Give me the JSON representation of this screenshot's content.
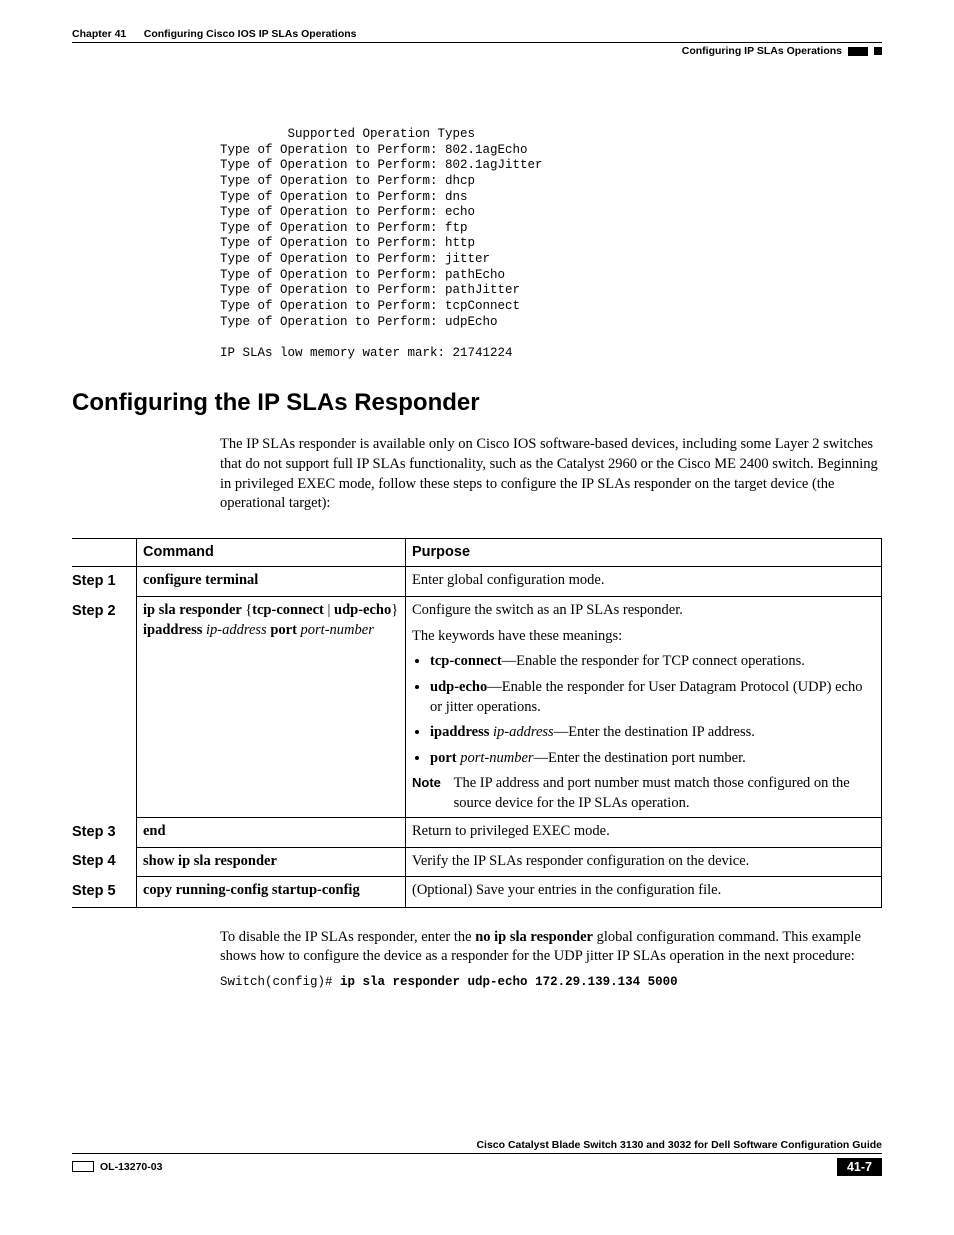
{
  "header": {
    "chapter_line": "Chapter 41      Configuring Cisco IOS IP SLAs Operations",
    "section_right": "Configuring IP SLAs Operations"
  },
  "console_block": "         Supported Operation Types\nType of Operation to Perform: 802.1agEcho\nType of Operation to Perform: 802.1agJitter\nType of Operation to Perform: dhcp\nType of Operation to Perform: dns\nType of Operation to Perform: echo\nType of Operation to Perform: ftp\nType of Operation to Perform: http\nType of Operation to Perform: jitter\nType of Operation to Perform: pathEcho\nType of Operation to Perform: pathJitter\nType of Operation to Perform: tcpConnect\nType of Operation to Perform: udpEcho\n\nIP SLAs low memory water mark: 21741224",
  "section_title": "Configuring the IP SLAs Responder",
  "intro_paragraph": "The IP SLAs responder is available only on Cisco IOS software-based devices, including some Layer 2 switches that do not support full IP SLAs functionality, such as the Catalyst 2960 or the Cisco ME 2400 switch. Beginning in privileged EXEC mode, follow these steps to configure the IP SLAs responder on the target device (the operational target):",
  "table": {
    "col1_header": "Command",
    "col2_header": "Purpose",
    "steps": [
      {
        "label": "Step 1",
        "command_bold": "configure terminal",
        "purpose_html": "Enter global configuration mode."
      },
      {
        "label": "Step 2",
        "cmd_line1_b1": "ip sla responder ",
        "cmd_line1_plain": "{",
        "cmd_line1_b2": "tcp-connect",
        "cmd_line1_sep": " | ",
        "cmd_line1_b3": "udp-echo",
        "cmd_line1_b4": "} ",
        "cmd_line1_b5": "ipaddress ",
        "cmd_line1_i1": "ip-address",
        "cmd_line1_b6": " port",
        "cmd_line2_i": "port-number",
        "purpose_line1": "Configure the switch as an IP SLAs responder.",
        "purpose_line2": "The keywords have these meanings:",
        "bullet1_b": "tcp-connect",
        "bullet1_t": "—Enable the responder for TCP connect operations.",
        "bullet2_b": "udp-echo",
        "bullet2_t": "—Enable the responder for User Datagram Protocol (UDP) echo or jitter operations.",
        "bullet3_b": "ipaddress ",
        "bullet3_i": "ip-address",
        "bullet3_t": "—Enter the destination IP address.",
        "bullet4_b": "port ",
        "bullet4_i": "port-number",
        "bullet4_t": "—Enter the destination port number.",
        "note_label": "Note",
        "note_text": "The IP address and port number must match those configured on the source device for the IP SLAs operation."
      },
      {
        "label": "Step 3",
        "command_bold": "end",
        "purpose_html": "Return to privileged EXEC mode."
      },
      {
        "label": "Step 4",
        "command_bold": "show ip sla responder",
        "purpose_html": "Verify the IP SLAs responder configuration on the device."
      },
      {
        "label": "Step 5",
        "command_bold": "copy running-config startup-config",
        "purpose_html": "(Optional) Save your entries in the configuration file."
      }
    ]
  },
  "after_table": {
    "pre": "To disable the IP SLAs responder, enter the ",
    "bold": "no ip sla responder",
    "post": " global configuration command. This example shows how to configure the device as a responder for the UDP jitter IP SLAs operation in the next procedure:"
  },
  "cli_example": {
    "prompt": "Switch(config)# ",
    "bold": "ip sla responder udp-echo 172.29.139.134 5000"
  },
  "footer": {
    "guide_title": "Cisco Catalyst Blade Switch 3130 and 3032 for Dell Software Configuration Guide",
    "doc_id": "OL-13270-03",
    "page_num": "41-7"
  }
}
